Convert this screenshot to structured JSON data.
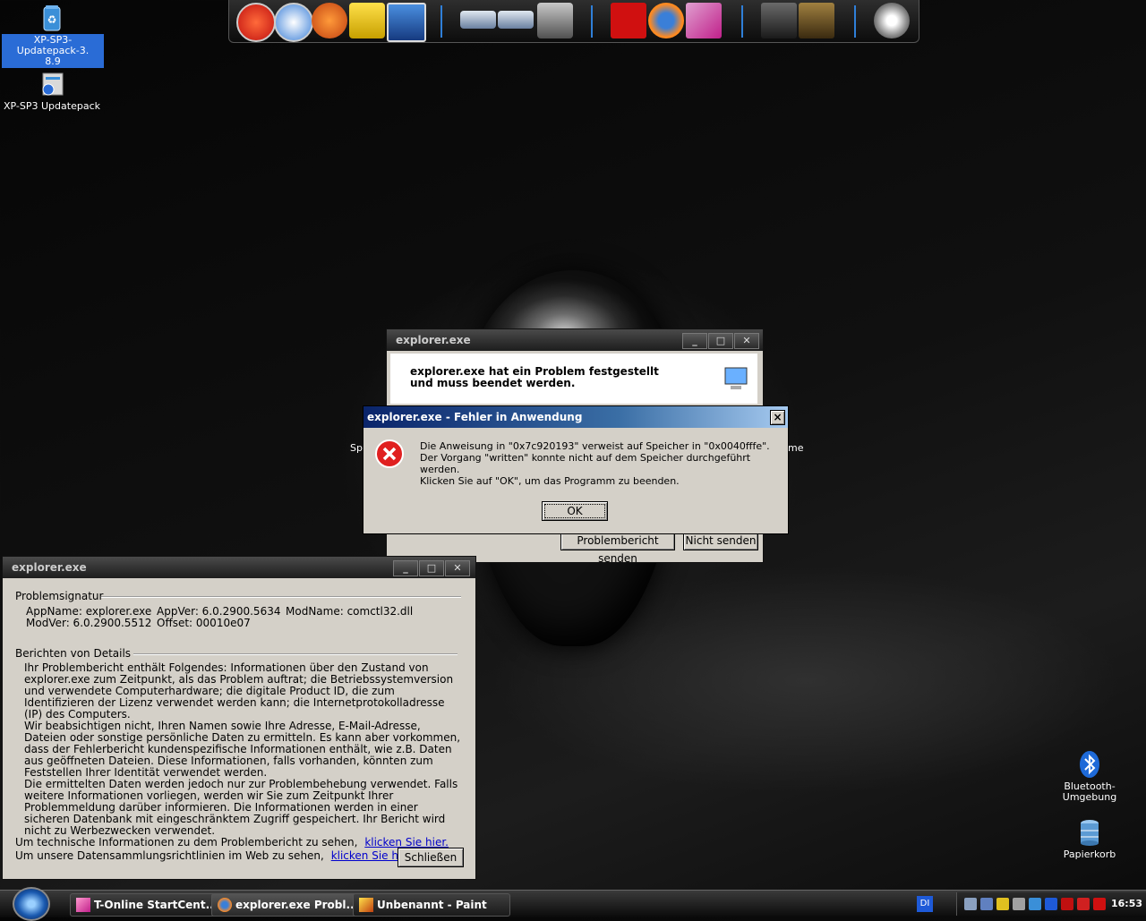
{
  "desktop": {
    "icons": [
      {
        "label": "XP-SP3-Updatepack-3.8.9",
        "line1": "XP-SP3-Updatepack-3.",
        "line2": "8.9"
      },
      {
        "label": "XP-SP3 Updatepack"
      },
      {
        "label": "Bluetooth-Umgebung"
      },
      {
        "label": "Papierkorb"
      }
    ],
    "partial_labels": {
      "left": "Sp",
      "right": "me"
    }
  },
  "problem_window": {
    "title": "explorer.exe",
    "header": "explorer.exe hat ein Problem festgestellt und muss beendet werden.",
    "buttons": {
      "send": "Problembericht senden",
      "dont_send": "Nicht senden"
    }
  },
  "error_dialog": {
    "title": "explorer.exe - Fehler in Anwendung",
    "close": "×",
    "message1": "Die Anweisung in \"0x7c920193\" verweist auf Speicher in \"0x0040fffe\". Der Vorgang \"written\" konnte nicht auf dem Speicher durchgeführt werden.",
    "message2": "Klicken Sie auf \"OK\", um das Programm zu beenden.",
    "ok": "OK"
  },
  "details_window": {
    "title": "explorer.exe",
    "signature_heading": "Problemsignatur",
    "appname": "AppName: explorer.exe",
    "appver": "AppVer: 6.0.2900.5634",
    "modname": "ModName: comctl32.dll",
    "modver": "ModVer: 6.0.2900.5512",
    "offset": "Offset: 00010e07",
    "details_heading": "Berichten von Details",
    "para1": "Ihr Problembericht enthält Folgendes: Informationen über den Zustand von explorer.exe zum Zeitpunkt, als das Problem auftrat; die Betriebssystemversion und verwendete Computerhardware; die digitale Product ID, die zum Identifizieren der Lizenz verwendet werden kann; die Internetprotokolladresse (IP) des Computers.",
    "para2": "Wir beabsichtigen nicht, Ihren Namen sowie Ihre Adresse, E-Mail-Adresse, Dateien oder sonstige persönliche Daten zu ermitteln. Es kann aber vorkommen, dass der Fehlerbericht kundenspezifische Informationen enthält, wie z.B. Daten aus geöffneten Dateien. Diese Informationen, falls vorhanden, könnten zum Feststellen Ihrer Identität verwendet werden.",
    "para3": "Die ermittelten Daten werden jedoch nur zur Problembehebung verwendet. Falls weitere Informationen vorliegen, werden wir Sie zum Zeitpunkt Ihrer Problemmeldung darüber informieren. Die Informationen werden in einer sicheren Datenbank mit eingeschränktem Zugriff gespeichert. Ihr Bericht wird nicht zu Werbezwecken verwendet.",
    "tech_text": "Um technische Informationen zu dem Problembericht zu sehen,",
    "tech_link": "klicken Sie hier.",
    "policy_text": "Um unsere Datensammlungsrichtlinien im Web zu sehen,",
    "policy_link": "klicken Sie hier.",
    "close_button": "Schließen"
  },
  "taskbar": {
    "tasks": [
      {
        "label": "T-Online StartCent..."
      },
      {
        "label": "explorer.exe Probl..."
      },
      {
        "label": "Unbenannt - Paint"
      }
    ],
    "lang": "DI",
    "clock": "16:53"
  }
}
